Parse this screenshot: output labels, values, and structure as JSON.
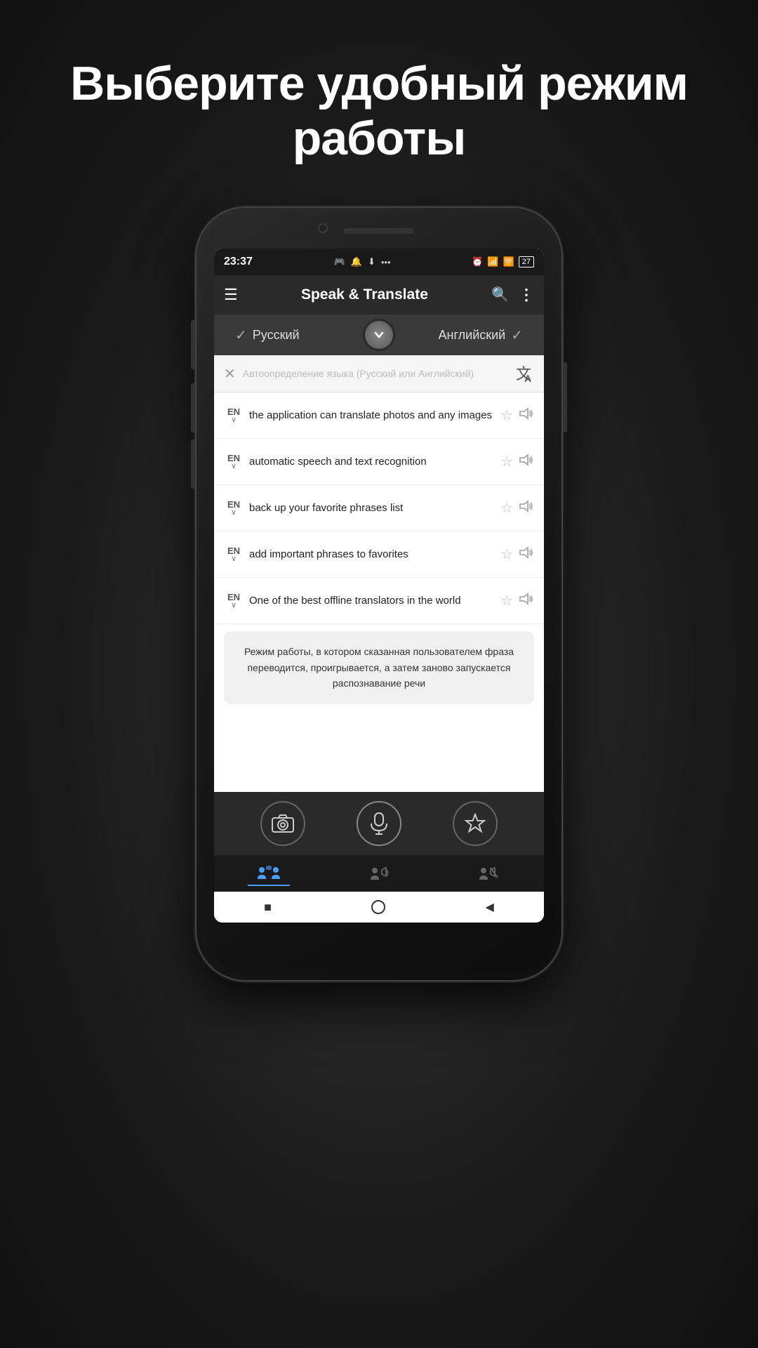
{
  "page": {
    "title_line1": "Выберите удобный режим",
    "title_line2": "работы"
  },
  "status_bar": {
    "time": "23:37",
    "left_icons": "🎮 🔔 ⬇ •••",
    "right_icons": "⏰ 📶 🛜 27"
  },
  "app_header": {
    "title": "Speak & Translate",
    "menu_icon": "☰",
    "search_icon": "🔍",
    "more_icon": "⋮"
  },
  "language_selector": {
    "left_lang": "Русский",
    "right_lang": "Английский",
    "check_left": "✓",
    "check_right": "✓",
    "switch_icon": "⌄"
  },
  "search_input": {
    "placeholder": "Автоопределение языка (Русский или Английский)"
  },
  "translation_items": [
    {
      "lang_code": "EN",
      "text": "the application can translate photos and any images"
    },
    {
      "lang_code": "EN",
      "text": "automatic speech and text recognition"
    },
    {
      "lang_code": "EN",
      "text": "back up your favorite phrases list"
    },
    {
      "lang_code": "EN",
      "text": "add important phrases to favorites"
    },
    {
      "lang_code": "EN",
      "text": "One of the best offline translators in the world"
    }
  ],
  "translation_output": {
    "text": "Режим работы, в котором сказанная пользователем фраза переводится, проигрывается, а затем заново запускается распознавание речи"
  },
  "mode_tabs": [
    {
      "label": "",
      "icon": "👥💬",
      "active": true
    },
    {
      "label": "",
      "icon": "👤🔊",
      "active": false
    },
    {
      "label": "",
      "icon": "👤🔇",
      "active": false
    }
  ],
  "android_nav": {
    "stop": "■",
    "home": "⬤",
    "back": "◀"
  }
}
